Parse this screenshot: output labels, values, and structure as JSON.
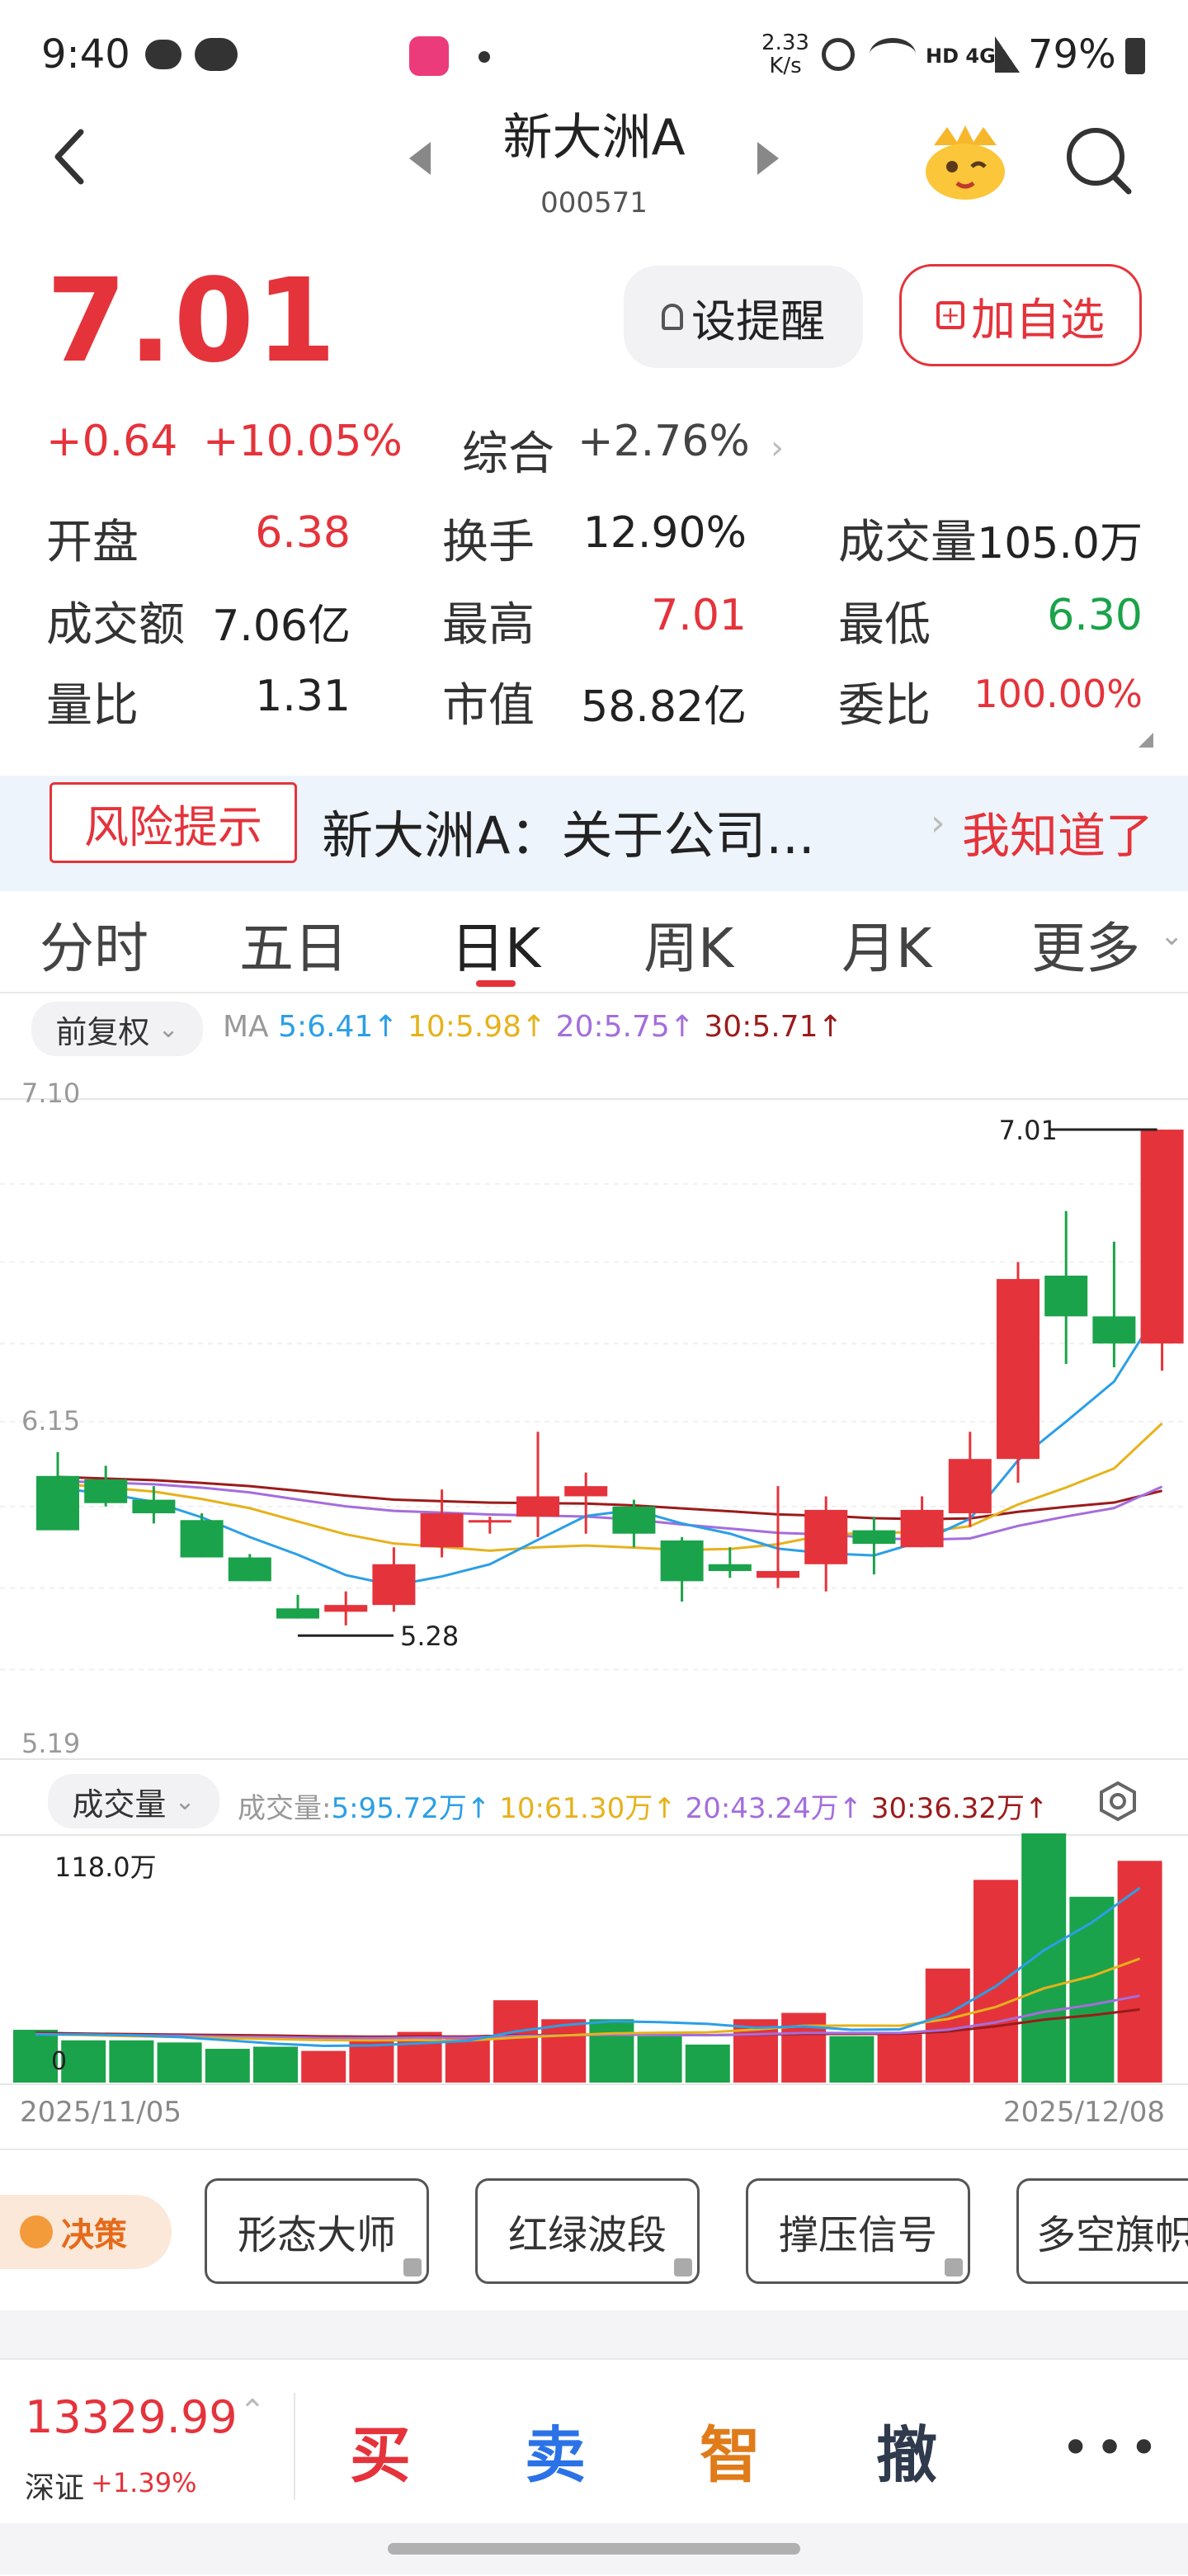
{
  "status_bar": {
    "time": "9:40",
    "speed": "2.33\nK/s",
    "network": "HD 4G",
    "battery": "79%"
  },
  "header": {
    "title": "新大洲A",
    "code": "000571"
  },
  "quote": {
    "price": "7.01",
    "change": "+0.64",
    "change_pct": "+10.05%",
    "composite_label": "综合",
    "composite_value": "+2.76%",
    "alert_label": "设提醒",
    "fav_label": "加自选",
    "stats": [
      {
        "label": "开盘",
        "value": "6.38",
        "color": "red"
      },
      {
        "label": "换手",
        "value": "12.90%",
        "color": "dark"
      },
      {
        "label": "成交量",
        "value": "105.0万",
        "color": "dark"
      },
      {
        "label": "成交额",
        "value": "7.06亿",
        "color": "dark"
      },
      {
        "label": "最高",
        "value": "7.01",
        "color": "red"
      },
      {
        "label": "最低",
        "value": "6.30",
        "color": "green"
      },
      {
        "label": "量比",
        "value": "1.31",
        "color": "dark"
      },
      {
        "label": "市值",
        "value": "58.82亿",
        "color": "dark"
      },
      {
        "label": "委比",
        "value": "100.00%",
        "color": "red"
      }
    ]
  },
  "risk": {
    "tag": "风险提示",
    "text": "新大洲A：关于公司...",
    "action": "我知道了"
  },
  "tabs": [
    "分时",
    "五日",
    "日K",
    "周K",
    "月K",
    "更多"
  ],
  "active_tab": "日K",
  "kline": {
    "adjust_label": "前复权",
    "ma_label": "MA",
    "ma5": "5:6.41↑",
    "ma10": "10:5.98↑",
    "ma20": "20:5.75↑",
    "ma30": "30:5.71↑",
    "y_top": "7.10",
    "y_mid": "6.15",
    "y_bottom": "5.19",
    "high_marker": "7.01",
    "low_marker": "5.28"
  },
  "volume": {
    "label": "成交量",
    "prefix": "成交量:",
    "ma5": "5:95.72万↑",
    "ma10": "10:61.30万↑",
    "ma20": "20:43.24万↑",
    "ma30": "30:36.32万↑",
    "top_label": "118.0万",
    "zero_label": "0",
    "date_start": "2025/11/05",
    "date_end": "2025/12/08"
  },
  "decision": {
    "badge": "决策",
    "buttons": [
      "形态大师",
      "红绿波段",
      "撑压信号",
      "多空旗帜"
    ]
  },
  "bottom": {
    "index_value": "13329.99",
    "index_name": "深证",
    "index_change": "+1.39%",
    "actions": [
      "买",
      "卖",
      "智",
      "撤"
    ]
  },
  "colors": {
    "up": "#e5333b",
    "down": "#1aa34a",
    "ma5": "#2b9fe6",
    "ma10": "#e6b21b",
    "ma20": "#a46ddd",
    "ma30": "#9b1b1b"
  },
  "chart_data": {
    "type": "candlestick",
    "title": "",
    "dates": {
      "start": "2025/11/05",
      "end": "2025/12/08"
    },
    "ylim": [
      5.19,
      7.1
    ],
    "candles": [
      {
        "o": 5.99,
        "h": 6.06,
        "l": 5.9,
        "c": 5.83
      },
      {
        "o": 5.98,
        "h": 6.02,
        "l": 5.9,
        "c": 5.91
      },
      {
        "o": 5.92,
        "h": 5.96,
        "l": 5.85,
        "c": 5.88
      },
      {
        "o": 5.86,
        "h": 5.88,
        "l": 5.75,
        "c": 5.75
      },
      {
        "o": 5.75,
        "h": 5.76,
        "l": 5.68,
        "c": 5.68
      },
      {
        "o": 5.6,
        "h": 5.64,
        "l": 5.57,
        "c": 5.57
      },
      {
        "o": 5.59,
        "h": 5.65,
        "l": 5.55,
        "c": 5.61
      },
      {
        "o": 5.61,
        "h": 5.78,
        "l": 5.59,
        "c": 5.73
      },
      {
        "o": 5.78,
        "h": 5.95,
        "l": 5.75,
        "c": 5.88
      },
      {
        "o": 5.86,
        "h": 5.87,
        "l": 5.82,
        "c": 5.86
      },
      {
        "o": 5.87,
        "h": 6.12,
        "l": 5.81,
        "c": 5.93
      },
      {
        "o": 5.93,
        "h": 6.0,
        "l": 5.82,
        "c": 5.96
      },
      {
        "o": 5.9,
        "h": 5.92,
        "l": 5.78,
        "c": 5.82
      },
      {
        "o": 5.8,
        "h": 5.81,
        "l": 5.62,
        "c": 5.68
      },
      {
        "o": 5.73,
        "h": 5.78,
        "l": 5.69,
        "c": 5.71
      },
      {
        "o": 5.69,
        "h": 5.96,
        "l": 5.66,
        "c": 5.71
      },
      {
        "o": 5.73,
        "h": 5.93,
        "l": 5.65,
        "c": 5.89
      },
      {
        "o": 5.83,
        "h": 5.87,
        "l": 5.7,
        "c": 5.79
      },
      {
        "o": 5.78,
        "h": 5.93,
        "l": 5.78,
        "c": 5.89
      },
      {
        "o": 5.88,
        "h": 6.12,
        "l": 5.84,
        "c": 6.04
      },
      {
        "o": 6.04,
        "h": 6.62,
        "l": 5.97,
        "c": 6.57
      },
      {
        "o": 6.58,
        "h": 6.77,
        "l": 6.32,
        "c": 6.46
      },
      {
        "o": 6.46,
        "h": 6.68,
        "l": 6.31,
        "c": 6.38
      },
      {
        "o": 6.38,
        "h": 7.01,
        "l": 6.3,
        "c": 7.01
      }
    ],
    "volumes": [
      25,
      20,
      20,
      19,
      16,
      17,
      15,
      21,
      24,
      22,
      39,
      30,
      30,
      22,
      18,
      30,
      33,
      22,
      23,
      54,
      96,
      118,
      88,
      105
    ]
  }
}
